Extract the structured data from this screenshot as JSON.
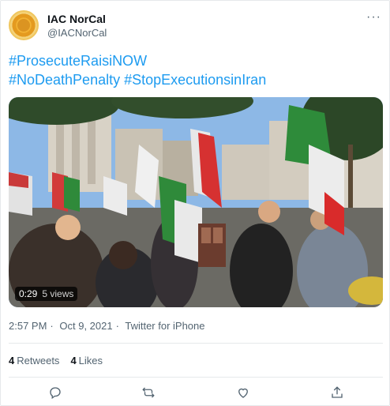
{
  "tweet": {
    "author": {
      "display_name": "IAC NorCal",
      "handle": "@IACNorCal"
    },
    "more_glyph": "···",
    "text_lines": [
      "#ProsecuteRaisiNOW",
      "#NoDeathPenalty #StopExecutionsinIran"
    ],
    "video": {
      "duration": "0:29",
      "views": "5 views"
    },
    "meta": {
      "time": "2:57 PM",
      "sep1": "·",
      "date": "Oct 9, 2021",
      "sep2": "·",
      "source": "Twitter for iPhone"
    },
    "stats": {
      "retweets_count": "4",
      "retweets_label": "Retweets",
      "likes_count": "4",
      "likes_label": "Likes"
    },
    "colors": {
      "link": "#1d9bf0",
      "secondary": "#536471",
      "primary": "#0f1419"
    },
    "actions": [
      "reply-icon",
      "retweet-icon",
      "like-icon",
      "share-icon"
    ]
  }
}
